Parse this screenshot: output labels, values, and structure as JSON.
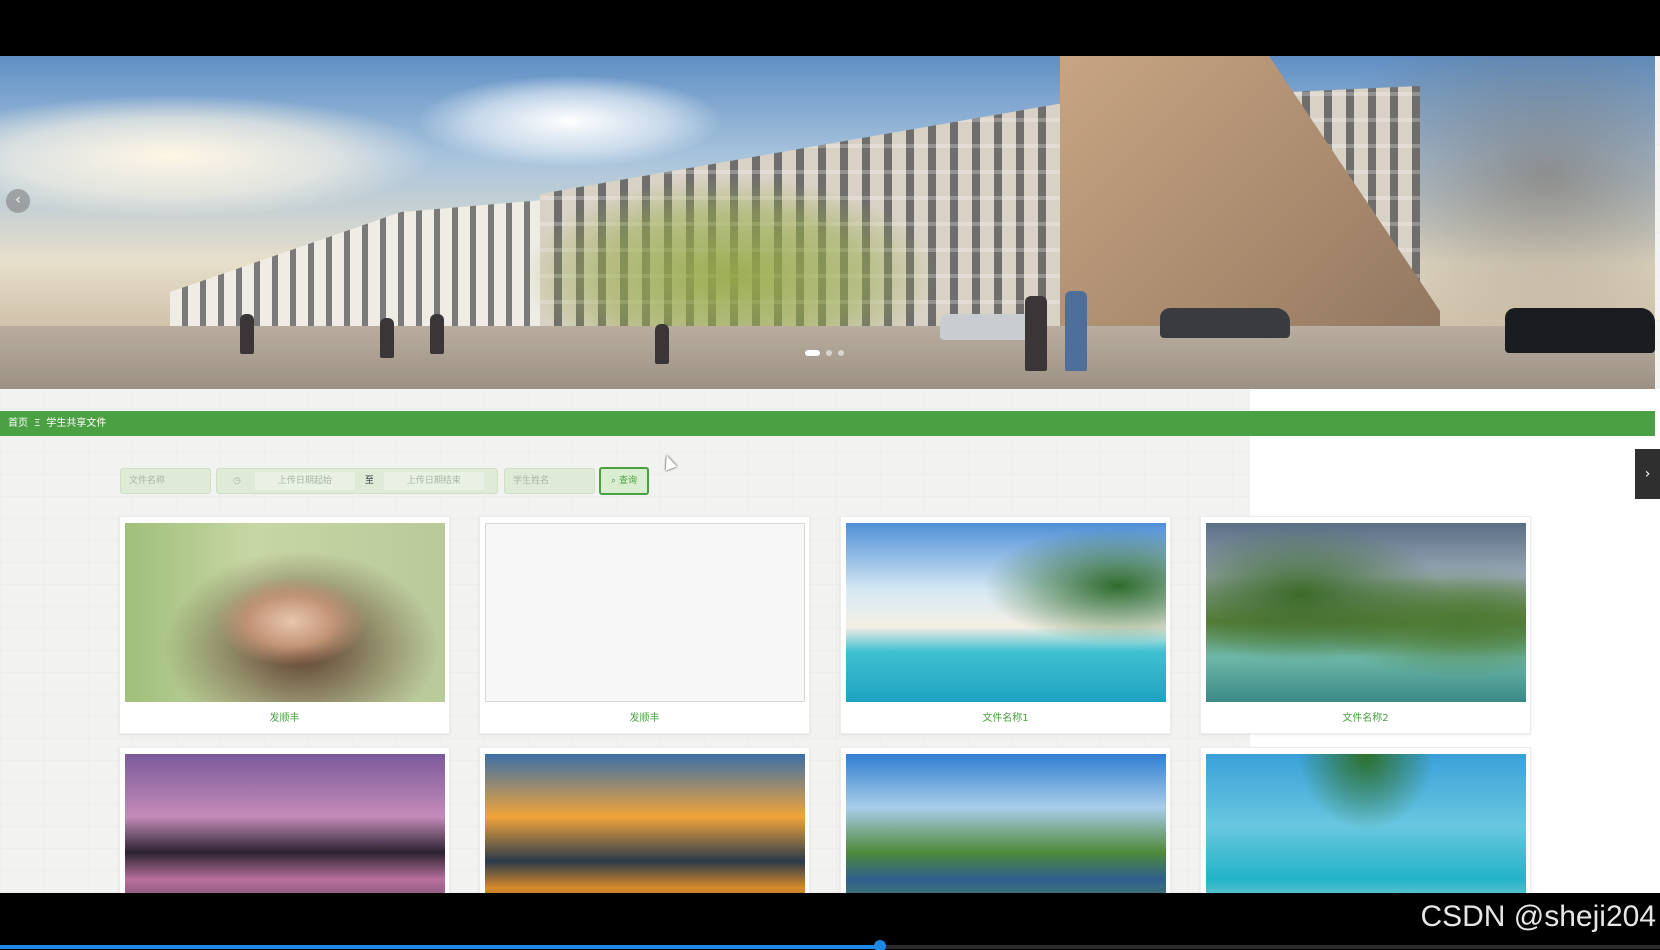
{
  "carousel": {
    "prev_label": "‹",
    "dots": 3,
    "active_dot": 0
  },
  "breadcrumb": {
    "home": "首页",
    "separator": "Ξ",
    "current": "学生共享文件"
  },
  "search": {
    "file_name_placeholder": "文件名称",
    "date_start_placeholder": "上传日期起始",
    "date_separator": "至",
    "date_end_placeholder": "上传日期结束",
    "student_name_placeholder": "学生姓名",
    "query_label": "查询",
    "query_icon": "search-icon",
    "clock_icon": "clock-icon"
  },
  "cards": [
    {
      "title": "发顺丰",
      "image": "portrait-woman"
    },
    {
      "title": "发顺丰",
      "image": "broken-image"
    },
    {
      "title": "文件名称1",
      "image": "tropical-beach"
    },
    {
      "title": "文件名称2",
      "image": "river-landscape"
    },
    {
      "title": "",
      "image": "mountain-lake-sunset"
    },
    {
      "title": "",
      "image": "lake-sunset-clouds"
    },
    {
      "title": "",
      "image": "green-valley-lake"
    },
    {
      "title": "",
      "image": "lagoon-palm"
    }
  ],
  "side_tab": {
    "label": "›"
  },
  "watermark": "CSDN @sheji204",
  "video_progress": 0.53,
  "colors": {
    "accent": "#4aa043",
    "progress": "#1e88e5"
  }
}
